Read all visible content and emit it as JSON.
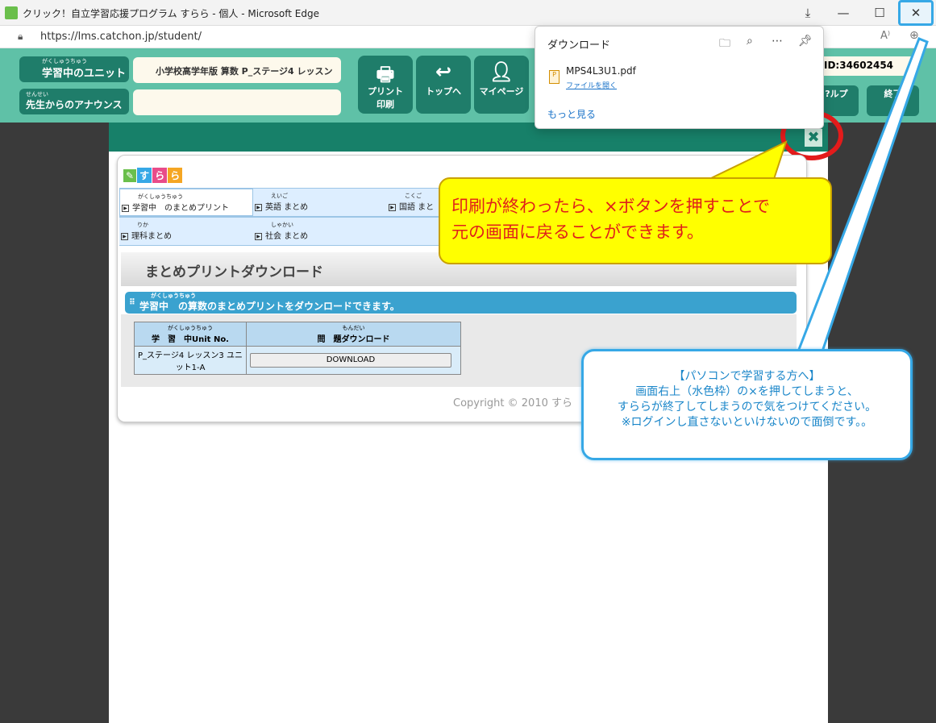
{
  "window": {
    "title": "クリック！自立学習応援プログラム すらら - 個人 - Microsoft Edge",
    "download_icon": "download-icon",
    "minimize_icon": "minimize-icon",
    "maximize_icon": "maximize-icon",
    "close_icon": "close-icon",
    "close_highlight_color": "#36a8e6"
  },
  "address": {
    "url": "https://lms.catchon.jp/student/",
    "read_aloud": "A̶"
  },
  "header": {
    "unit_label": "学習中のユニット",
    "unit_ruby": "がくしゅうちゅう",
    "unit_value": "小学校高学年版 算数 P_ステージ4 レッスン",
    "announce_label": "先生からのアナウンス",
    "announce_ruby": "せんせい",
    "announce_value": "",
    "buttons": [
      {
        "icon": "printer-icon",
        "label": "プリント印刷",
        "line1": "プリント",
        "line2": "印刷"
      },
      {
        "icon": "return-icon",
        "label": "トップへ"
      },
      {
        "icon": "person-icon",
        "label": "マイページ"
      }
    ],
    "user_id": "ID:34602454",
    "help_label": "?ルプ",
    "end_label": "終了"
  },
  "modal": {
    "close_symbol": "✖",
    "logo_letters": [
      "す",
      "ら",
      "ら"
    ],
    "nav_items": [
      {
        "ruby": "がくしゅうちゅう",
        "label": "学習中　のまとめプリント"
      },
      {
        "ruby": "えいご",
        "label": "英語 まとめ"
      },
      {
        "ruby": "こくご",
        "label": "国語 まと"
      },
      {
        "ruby": "りか",
        "label": "理科まとめ"
      },
      {
        "ruby": "しゃかい",
        "label": "社会 まとめ"
      }
    ],
    "page_title": "まとめプリントダウンロード",
    "bar_ruby": "がくしゅうちゅう",
    "bar_text": "学習中　の算数のまとめプリントをダウンロードできます。",
    "table": {
      "col1_ruby": "がくしゅうちゅう",
      "col1": "学　習　中Unit No.",
      "col2_ruby": "もんだい",
      "col2": "問　題ダウンロード",
      "row_unit": "P_ステージ4 レッスン3 ユニット1-A",
      "row_button": "DOWNLOAD"
    },
    "copyright": "Copyright © 2010 すら"
  },
  "callout_yellow": {
    "line1": "印刷が終わったら、×ボタンを押すことで",
    "line2": "元の画面に戻ることができます。"
  },
  "callout_blue": {
    "line1": "【パソコンで学習する方へ】",
    "line2": "画面右上（水色枠）の×を押してしまうと、",
    "line3": "すららが終了してしまうので気をつけてください。",
    "line4": "※ログインし直さないといけないので面倒です。。"
  },
  "download_panel": {
    "title": "ダウンロード",
    "icons": [
      "folder-icon",
      "search-icon",
      "more-icon",
      "pin-icon"
    ],
    "file_name": "MPS4L3U1.pdf",
    "open_file": "ファイルを開く",
    "more_link": "もっと見る"
  }
}
